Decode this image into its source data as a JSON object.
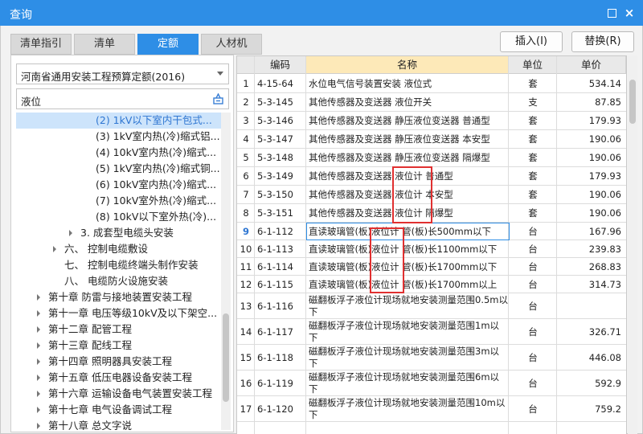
{
  "window": {
    "title": "查询",
    "minimize_icon": "restore-icon",
    "close_label": "×"
  },
  "tabs": [
    {
      "label": "清单指引",
      "active": false
    },
    {
      "label": "清单",
      "active": false
    },
    {
      "label": "定额",
      "active": true
    },
    {
      "label": "人材机",
      "active": false
    }
  ],
  "actions": {
    "insert_label": "插入(I)",
    "replace_label": "替换(R)"
  },
  "left": {
    "quota_select": "河南省通用安装工程预算定额(2016)",
    "search_value": "液位",
    "tree": [
      {
        "label": "(2) 1kV以下室内干包式...",
        "level": 3,
        "selected": true,
        "expander": false
      },
      {
        "label": "(3) 1kV室内热(冷)缩式铝...",
        "level": 3,
        "selected": false,
        "expander": false
      },
      {
        "label": "(4) 10kV室内热(冷)缩式...",
        "level": 3,
        "selected": false,
        "expander": false
      },
      {
        "label": "(5) 1kV室内热(冷)缩式铜...",
        "level": 3,
        "selected": false,
        "expander": false
      },
      {
        "label": "(6) 10kV室内热(冷)缩式...",
        "level": 3,
        "selected": false,
        "expander": false
      },
      {
        "label": "(7) 10kV室外热(冷)缩式...",
        "level": 3,
        "selected": false,
        "expander": false
      },
      {
        "label": "(8) 10kV以下室外热(冷)...",
        "level": 3,
        "selected": false,
        "expander": false
      },
      {
        "label": "3. 成套型电缆头安装",
        "level": 2,
        "selected": false,
        "expander": true
      },
      {
        "label": "六、 控制电缆敷设",
        "level": 1,
        "selected": false,
        "expander": true
      },
      {
        "label": "七、 控制电缆终端头制作安装",
        "level": 1,
        "selected": false,
        "expander": false
      },
      {
        "label": "八、 电缆防火设施安装",
        "level": 1,
        "selected": false,
        "expander": false
      },
      {
        "label": "第十章 防雷与接地装置安装工程",
        "level": 0,
        "selected": false,
        "expander": true
      },
      {
        "label": "第十一章 电压等级10kV及以下架空...",
        "level": 0,
        "selected": false,
        "expander": true
      },
      {
        "label": "第十二章 配管工程",
        "level": 0,
        "selected": false,
        "expander": true
      },
      {
        "label": "第十三章 配线工程",
        "level": 0,
        "selected": false,
        "expander": true
      },
      {
        "label": "第十四章 照明器具安装工程",
        "level": 0,
        "selected": false,
        "expander": true
      },
      {
        "label": "第十五章 低压电器设备安装工程",
        "level": 0,
        "selected": false,
        "expander": true
      },
      {
        "label": "第十六章 运输设备电气装置安装工程",
        "level": 0,
        "selected": false,
        "expander": true
      },
      {
        "label": "第十七章 电气设备调试工程",
        "level": 0,
        "selected": false,
        "expander": true
      },
      {
        "label": "第十八章 总文字说",
        "level": 0,
        "selected": false,
        "expander": true
      }
    ]
  },
  "table": {
    "headers": {
      "code": "编码",
      "name": "名称",
      "unit": "单位",
      "price": "单价"
    },
    "rows": [
      {
        "n": "1",
        "code": "4-15-64",
        "name": "水位电气信号装置安装 液位式",
        "unit": "套",
        "price": "534.14"
      },
      {
        "n": "2",
        "code": "5-3-145",
        "name": "其他传感器及变送器 液位开关",
        "unit": "支",
        "price": "87.85"
      },
      {
        "n": "3",
        "code": "5-3-146",
        "name": "其他传感器及变送器 静压液位变送器 普通型",
        "unit": "套",
        "price": "179.93"
      },
      {
        "n": "4",
        "code": "5-3-147",
        "name": "其他传感器及变送器 静压液位变送器 本安型",
        "unit": "套",
        "price": "190.06"
      },
      {
        "n": "5",
        "code": "5-3-148",
        "name": "其他传感器及变送器 静压液位变送器 隔爆型",
        "unit": "套",
        "price": "190.06"
      },
      {
        "n": "6",
        "code": "5-3-149",
        "name": "其他传感器及变送器 液位计 普通型",
        "unit": "套",
        "price": "179.93"
      },
      {
        "n": "7",
        "code": "5-3-150",
        "name": "其他传感器及变送器 液位计 本安型",
        "unit": "套",
        "price": "190.06"
      },
      {
        "n": "8",
        "code": "5-3-151",
        "name": "其他传感器及变送器 液位计 隔爆型",
        "unit": "套",
        "price": "190.06"
      },
      {
        "n": "9",
        "code": "6-1-112",
        "name": "直读玻璃管(板)液位计 管(板)长500mm以下",
        "unit": "台",
        "price": "167.96"
      },
      {
        "n": "10",
        "code": "6-1-113",
        "name": "直读玻璃管(板)液位计 管(板)长1100mm以下",
        "unit": "台",
        "price": "239.83"
      },
      {
        "n": "11",
        "code": "6-1-114",
        "name": "直读玻璃管(板)液位计 管(板)长1700mm以下",
        "unit": "台",
        "price": "268.83"
      },
      {
        "n": "12",
        "code": "6-1-115",
        "name": "直读玻璃管(板)液位计 管(板)长1700mm以上",
        "unit": "台",
        "price": "314.73"
      },
      {
        "n": "13",
        "code": "6-1-116",
        "name": "磁翻板浮子液位计现场就地安装测量范围0.5m以下",
        "unit": "台",
        "price": ""
      },
      {
        "n": "14",
        "code": "6-1-117",
        "name": "磁翻板浮子液位计现场就地安装测量范围1m以下",
        "unit": "台",
        "price": "326.71"
      },
      {
        "n": "15",
        "code": "6-1-118",
        "name": "磁翻板浮子液位计现场就地安装测量范围3m以下",
        "unit": "台",
        "price": "446.08"
      },
      {
        "n": "16",
        "code": "6-1-119",
        "name": "磁翻板浮子液位计现场就地安装测量范围6m以下",
        "unit": "台",
        "price": "592.9"
      },
      {
        "n": "17",
        "code": "6-1-120",
        "name": "磁翻板浮子液位计现场就地安装测量范围10m以下",
        "unit": "台",
        "price": "759.2"
      }
    ],
    "current_row": "9"
  },
  "colors": {
    "accent": "#2e8ee6",
    "highlight_box": "#e03030",
    "name_header": "#fde9b8"
  }
}
